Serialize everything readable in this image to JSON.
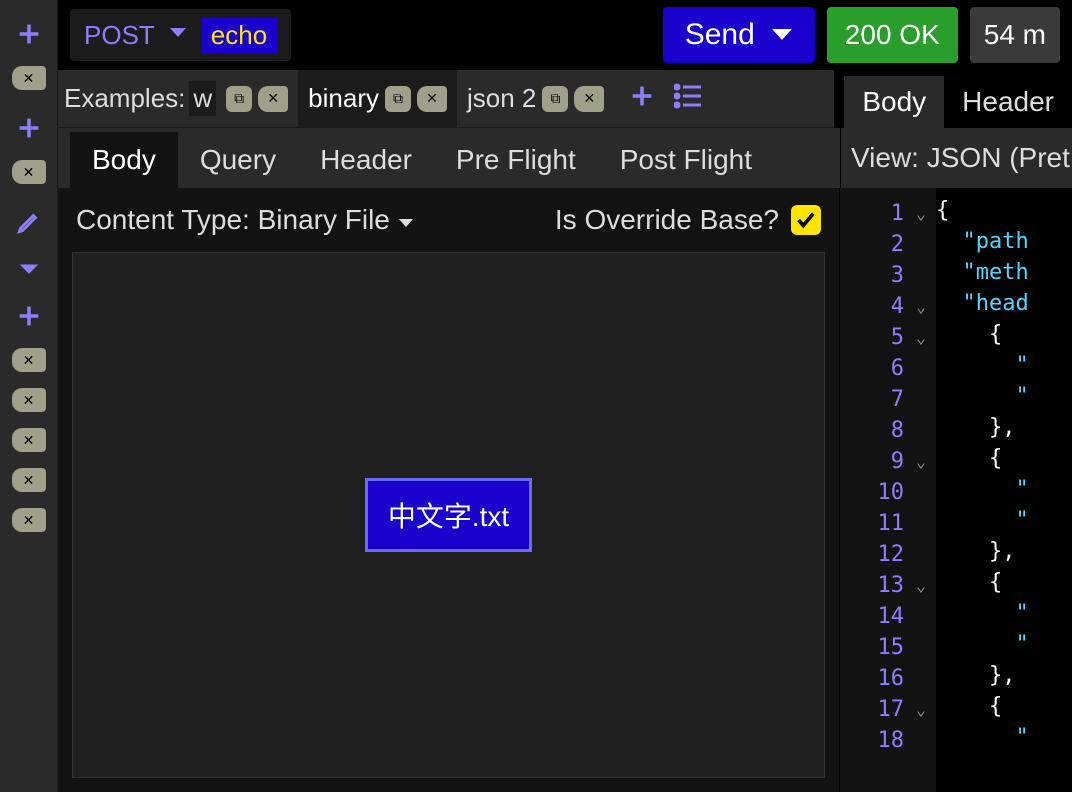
{
  "request": {
    "method": "POST",
    "url": "echo",
    "send_label": "Send"
  },
  "status": {
    "code_text": "200 OK",
    "time_text": "54 m"
  },
  "examples": {
    "prefix": "Examples:",
    "first_frag": "w",
    "tabs": [
      {
        "label": "binary",
        "active": true
      },
      {
        "label": "json 2",
        "active": false
      }
    ]
  },
  "response_tabs": {
    "items": [
      "Body",
      "Header"
    ],
    "active": "Body"
  },
  "request_tabs": {
    "items": [
      "Body",
      "Query",
      "Header",
      "Pre Flight",
      "Post Flight"
    ],
    "active": "Body"
  },
  "view": {
    "label": "View: JSON (Pret"
  },
  "content_type": {
    "label": "Content Type: Binary File",
    "override_label": "Is Override Base?",
    "override_checked": true
  },
  "file": {
    "name": "中文字.txt"
  },
  "response_code": {
    "lines": [
      {
        "n": 1,
        "fold": true,
        "text": "{"
      },
      {
        "n": 2,
        "fold": false,
        "text": "  \"path"
      },
      {
        "n": 3,
        "fold": false,
        "text": "  \"meth"
      },
      {
        "n": 4,
        "fold": true,
        "text": "  \"head"
      },
      {
        "n": 5,
        "fold": true,
        "text": "    {"
      },
      {
        "n": 6,
        "fold": false,
        "text": "      \""
      },
      {
        "n": 7,
        "fold": false,
        "text": "      \""
      },
      {
        "n": 8,
        "fold": false,
        "text": "    },"
      },
      {
        "n": 9,
        "fold": true,
        "text": "    {"
      },
      {
        "n": 10,
        "fold": false,
        "text": "      \""
      },
      {
        "n": 11,
        "fold": false,
        "text": "      \""
      },
      {
        "n": 12,
        "fold": false,
        "text": "    },"
      },
      {
        "n": 13,
        "fold": true,
        "text": "    {"
      },
      {
        "n": 14,
        "fold": false,
        "text": "      \""
      },
      {
        "n": 15,
        "fold": false,
        "text": "      \""
      },
      {
        "n": 16,
        "fold": false,
        "text": "    },"
      },
      {
        "n": 17,
        "fold": true,
        "text": "    {"
      },
      {
        "n": 18,
        "fold": false,
        "text": "      \""
      }
    ]
  }
}
